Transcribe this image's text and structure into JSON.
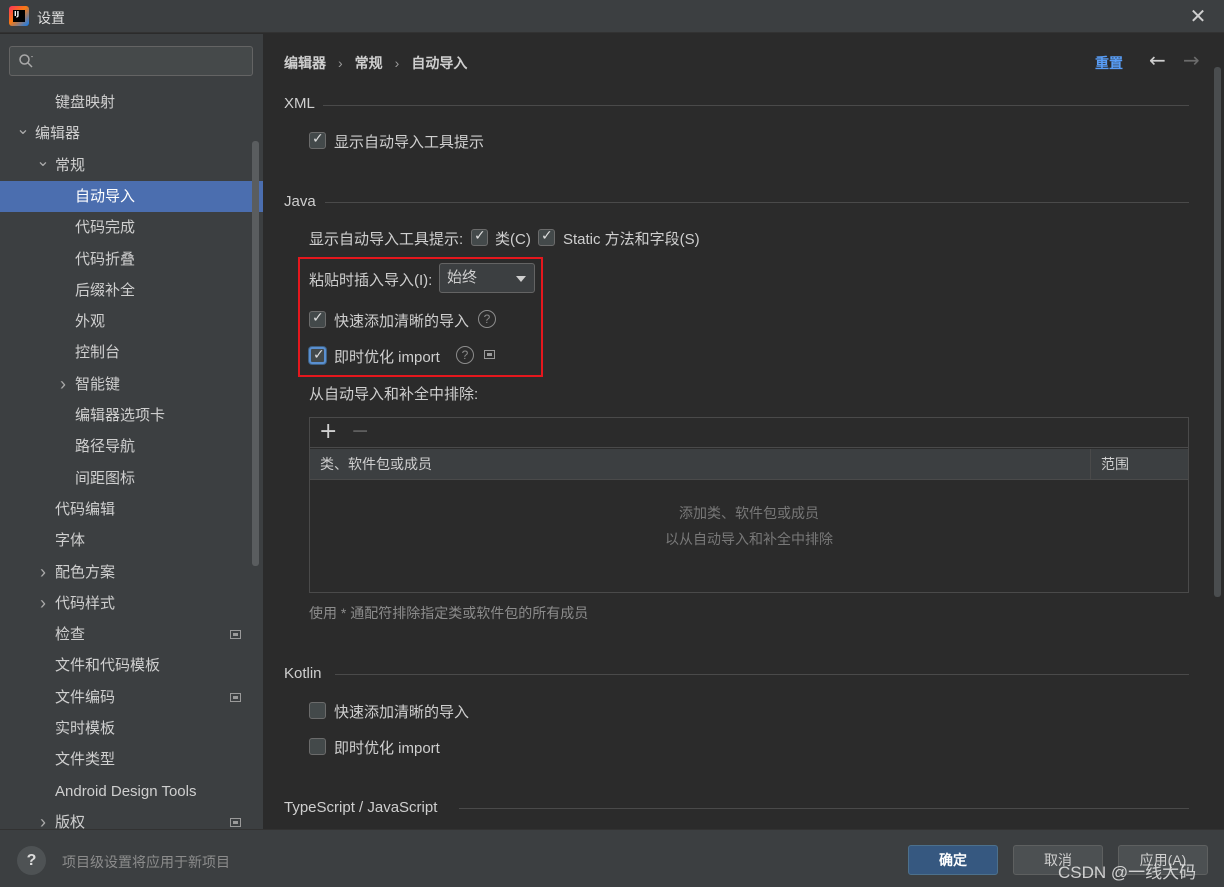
{
  "window": {
    "title": "设置"
  },
  "search": {
    "placeholder": ""
  },
  "sidebar": {
    "items": [
      {
        "label": "键盘映射",
        "level": 1,
        "expanded": null
      },
      {
        "label": "编辑器",
        "level": 0,
        "expanded": true
      },
      {
        "label": "常规",
        "level": 1,
        "expanded": true
      },
      {
        "label": "自动导入",
        "level": 2,
        "expanded": null,
        "selected": true
      },
      {
        "label": "代码完成",
        "level": 2,
        "expanded": null
      },
      {
        "label": "代码折叠",
        "level": 2,
        "expanded": null
      },
      {
        "label": "后缀补全",
        "level": 2,
        "expanded": null
      },
      {
        "label": "外观",
        "level": 2,
        "expanded": null
      },
      {
        "label": "控制台",
        "level": 2,
        "expanded": null
      },
      {
        "label": "智能键",
        "level": 2,
        "expanded": false
      },
      {
        "label": "编辑器选项卡",
        "level": 2,
        "expanded": null
      },
      {
        "label": "路径导航",
        "level": 2,
        "expanded": null
      },
      {
        "label": "间距图标",
        "level": 2,
        "expanded": null
      },
      {
        "label": "代码编辑",
        "level": 1,
        "expanded": null
      },
      {
        "label": "字体",
        "level": 1,
        "expanded": null
      },
      {
        "label": "配色方案",
        "level": 1,
        "expanded": false
      },
      {
        "label": "代码样式",
        "level": 1,
        "expanded": false
      },
      {
        "label": "检查",
        "level": 1,
        "expanded": null,
        "project_icon": true
      },
      {
        "label": "文件和代码模板",
        "level": 1,
        "expanded": null
      },
      {
        "label": "文件编码",
        "level": 1,
        "expanded": null,
        "project_icon": true
      },
      {
        "label": "实时模板",
        "level": 1,
        "expanded": null
      },
      {
        "label": "文件类型",
        "level": 1,
        "expanded": null
      },
      {
        "label": "Android Design Tools",
        "level": 1,
        "expanded": null
      },
      {
        "label": "版权",
        "level": 1,
        "expanded": false,
        "project_icon": true
      }
    ]
  },
  "breadcrumb": {
    "items": [
      "编辑器",
      "常规",
      "自动导入"
    ],
    "separator": "›"
  },
  "header": {
    "reset_label": "重置",
    "back_icon": "arrow-left-icon",
    "forward_icon": "arrow-right-icon"
  },
  "xml": {
    "title": "XML",
    "show_tooltip": {
      "label": "显示自动导入工具提示",
      "checked": true
    }
  },
  "java": {
    "title": "Java",
    "show_tooltip_label": "显示自动导入工具提示:",
    "class_option": {
      "label": "类(C)",
      "checked": true
    },
    "static_option": {
      "label": "Static 方法和字段(S)",
      "checked": true
    },
    "paste_label": "粘贴时插入导入(I):",
    "paste_value": "始终",
    "add_unambiguous": {
      "label": "快速添加清晰的导入",
      "checked": true
    },
    "optimize_imports": {
      "label": "即时优化 import",
      "checked": true
    },
    "exclude_label": "从自动导入和补全中排除:",
    "table": {
      "columns": [
        "类、软件包或成员",
        "范围"
      ],
      "empty_line1": "添加类、软件包或成员",
      "empty_line2": "以从自动导入和补全中排除",
      "add_label": "+",
      "remove_label": "−"
    },
    "hint": "使用 * 通配符排除指定类或软件包的所有成员"
  },
  "kotlin": {
    "title": "Kotlin",
    "add_unambiguous": {
      "label": "快速添加清晰的导入",
      "checked": false
    },
    "optimize_imports": {
      "label": "即时优化 import",
      "checked": false
    }
  },
  "typescript": {
    "title": "TypeScript / JavaScript"
  },
  "footer": {
    "help_label": "?",
    "note": "项目级设置将应用于新项目",
    "ok_label": "确定",
    "cancel_label": "取消",
    "apply_label": "应用(A)",
    "watermark": "CSDN @一线大码"
  },
  "colors": {
    "accent": "#589df6",
    "selected": "#4b6eaf",
    "highlight_box": "#e5171d"
  }
}
